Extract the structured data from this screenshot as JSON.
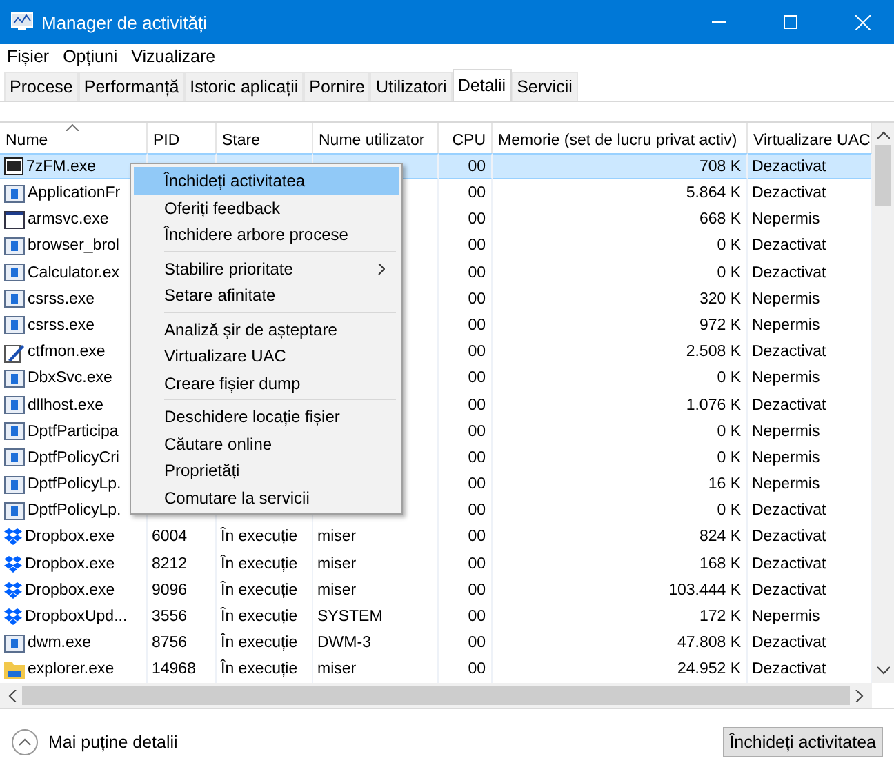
{
  "window": {
    "title": "Manager de activități"
  },
  "menu_bar": [
    "Fișier",
    "Opțiuni",
    "Vizualizare"
  ],
  "tabs": [
    {
      "label": "Procese",
      "selected": false
    },
    {
      "label": "Performanță",
      "selected": false
    },
    {
      "label": "Istoric aplicații",
      "selected": false
    },
    {
      "label": "Pornire",
      "selected": false
    },
    {
      "label": "Utilizatori",
      "selected": false
    },
    {
      "label": "Detalii",
      "selected": true
    },
    {
      "label": "Servicii",
      "selected": false
    }
  ],
  "table": {
    "columns": [
      "Nume",
      "PID",
      "Stare",
      "Nume utilizator",
      "CPU",
      "Memorie (set de lucru privat activ)",
      "Virtualizare UAC"
    ],
    "rows": [
      {
        "kind": "archive",
        "selected": true,
        "cells": [
          "7zFM.exe",
          "",
          "",
          "",
          "00",
          "708 K",
          "Dezactivat"
        ]
      },
      {
        "kind": "app",
        "selected": false,
        "cells": [
          "ApplicationFr",
          "",
          "",
          "",
          "00",
          "5.864 K",
          "Dezactivat"
        ]
      },
      {
        "kind": "window",
        "selected": false,
        "cells": [
          "armsvc.exe",
          "",
          "",
          "",
          "00",
          "668 K",
          "Nepermis"
        ]
      },
      {
        "kind": "app",
        "selected": false,
        "cells": [
          "browser_brol",
          "",
          "",
          "",
          "00",
          "0 K",
          "Dezactivat"
        ]
      },
      {
        "kind": "app",
        "selected": false,
        "cells": [
          "Calculator.ex",
          "",
          "",
          "",
          "00",
          "0 K",
          "Dezactivat"
        ]
      },
      {
        "kind": "app",
        "selected": false,
        "cells": [
          "csrss.exe",
          "",
          "",
          "",
          "00",
          "320 K",
          "Nepermis"
        ]
      },
      {
        "kind": "app",
        "selected": false,
        "cells": [
          "csrss.exe",
          "",
          "",
          "",
          "00",
          "972 K",
          "Nepermis"
        ]
      },
      {
        "kind": "pen",
        "selected": false,
        "cells": [
          "ctfmon.exe",
          "",
          "",
          "",
          "00",
          "2.508 K",
          "Dezactivat"
        ]
      },
      {
        "kind": "app",
        "selected": false,
        "cells": [
          "DbxSvc.exe",
          "",
          "",
          "",
          "00",
          "0 K",
          "Nepermis"
        ]
      },
      {
        "kind": "app",
        "selected": false,
        "cells": [
          "dllhost.exe",
          "",
          "",
          "",
          "00",
          "1.076 K",
          "Dezactivat"
        ]
      },
      {
        "kind": "app",
        "selected": false,
        "cells": [
          "DptfParticipa",
          "",
          "",
          "",
          "00",
          "0 K",
          "Nepermis"
        ]
      },
      {
        "kind": "app",
        "selected": false,
        "cells": [
          "DptfPolicyCri",
          "",
          "",
          "",
          "00",
          "0 K",
          "Nepermis"
        ]
      },
      {
        "kind": "app",
        "selected": false,
        "cells": [
          "DptfPolicyLp.",
          "",
          "",
          "",
          "00",
          "16 K",
          "Nepermis"
        ]
      },
      {
        "kind": "app",
        "selected": false,
        "cells": [
          "DptfPolicyLp.",
          "",
          "",
          "",
          "00",
          "0 K",
          "Dezactivat"
        ]
      },
      {
        "kind": "dropbox",
        "selected": false,
        "cells": [
          "Dropbox.exe",
          "6004",
          "În execuție",
          "miser",
          "00",
          "824 K",
          "Dezactivat"
        ]
      },
      {
        "kind": "dropbox",
        "selected": false,
        "cells": [
          "Dropbox.exe",
          "8212",
          "În execuție",
          "miser",
          "00",
          "168 K",
          "Dezactivat"
        ]
      },
      {
        "kind": "dropbox",
        "selected": false,
        "cells": [
          "Dropbox.exe",
          "9096",
          "În execuție",
          "miser",
          "00",
          "103.444 K",
          "Dezactivat"
        ]
      },
      {
        "kind": "dropbox",
        "selected": false,
        "cells": [
          "DropboxUpd...",
          "3556",
          "În execuție",
          "SYSTEM",
          "00",
          "172 K",
          "Nepermis"
        ]
      },
      {
        "kind": "app",
        "selected": false,
        "cells": [
          "dwm.exe",
          "8756",
          "În execuție",
          "DWM-3",
          "00",
          "47.808 K",
          "Dezactivat"
        ]
      },
      {
        "kind": "folder",
        "selected": false,
        "cells": [
          "explorer.exe",
          "14968",
          "În execuție",
          "miser",
          "00",
          "24.952 K",
          "Dezactivat"
        ]
      }
    ]
  },
  "context_menu": {
    "groups": [
      [
        {
          "label": "Închideți activitatea",
          "selected": true,
          "submenu": false
        },
        {
          "label": "Oferiți feedback",
          "selected": false,
          "submenu": false
        },
        {
          "label": "Închidere arbore procese",
          "selected": false,
          "submenu": false
        }
      ],
      [
        {
          "label": "Stabilire prioritate",
          "selected": false,
          "submenu": true
        },
        {
          "label": "Setare afinitate",
          "selected": false,
          "submenu": false
        }
      ],
      [
        {
          "label": "Analiză șir de așteptare",
          "selected": false,
          "submenu": false
        },
        {
          "label": "Virtualizare UAC",
          "selected": false,
          "submenu": false
        },
        {
          "label": "Creare fișier dump",
          "selected": false,
          "submenu": false
        }
      ],
      [
        {
          "label": "Deschidere locație fișier",
          "selected": false,
          "submenu": false
        },
        {
          "label": "Căutare online",
          "selected": false,
          "submenu": false
        },
        {
          "label": "Proprietăți",
          "selected": false,
          "submenu": false
        },
        {
          "label": "Comutare la servicii",
          "selected": false,
          "submenu": false
        }
      ]
    ]
  },
  "footer": {
    "toggle": "Mai puține detalii",
    "button": "Închideți activitatea"
  }
}
